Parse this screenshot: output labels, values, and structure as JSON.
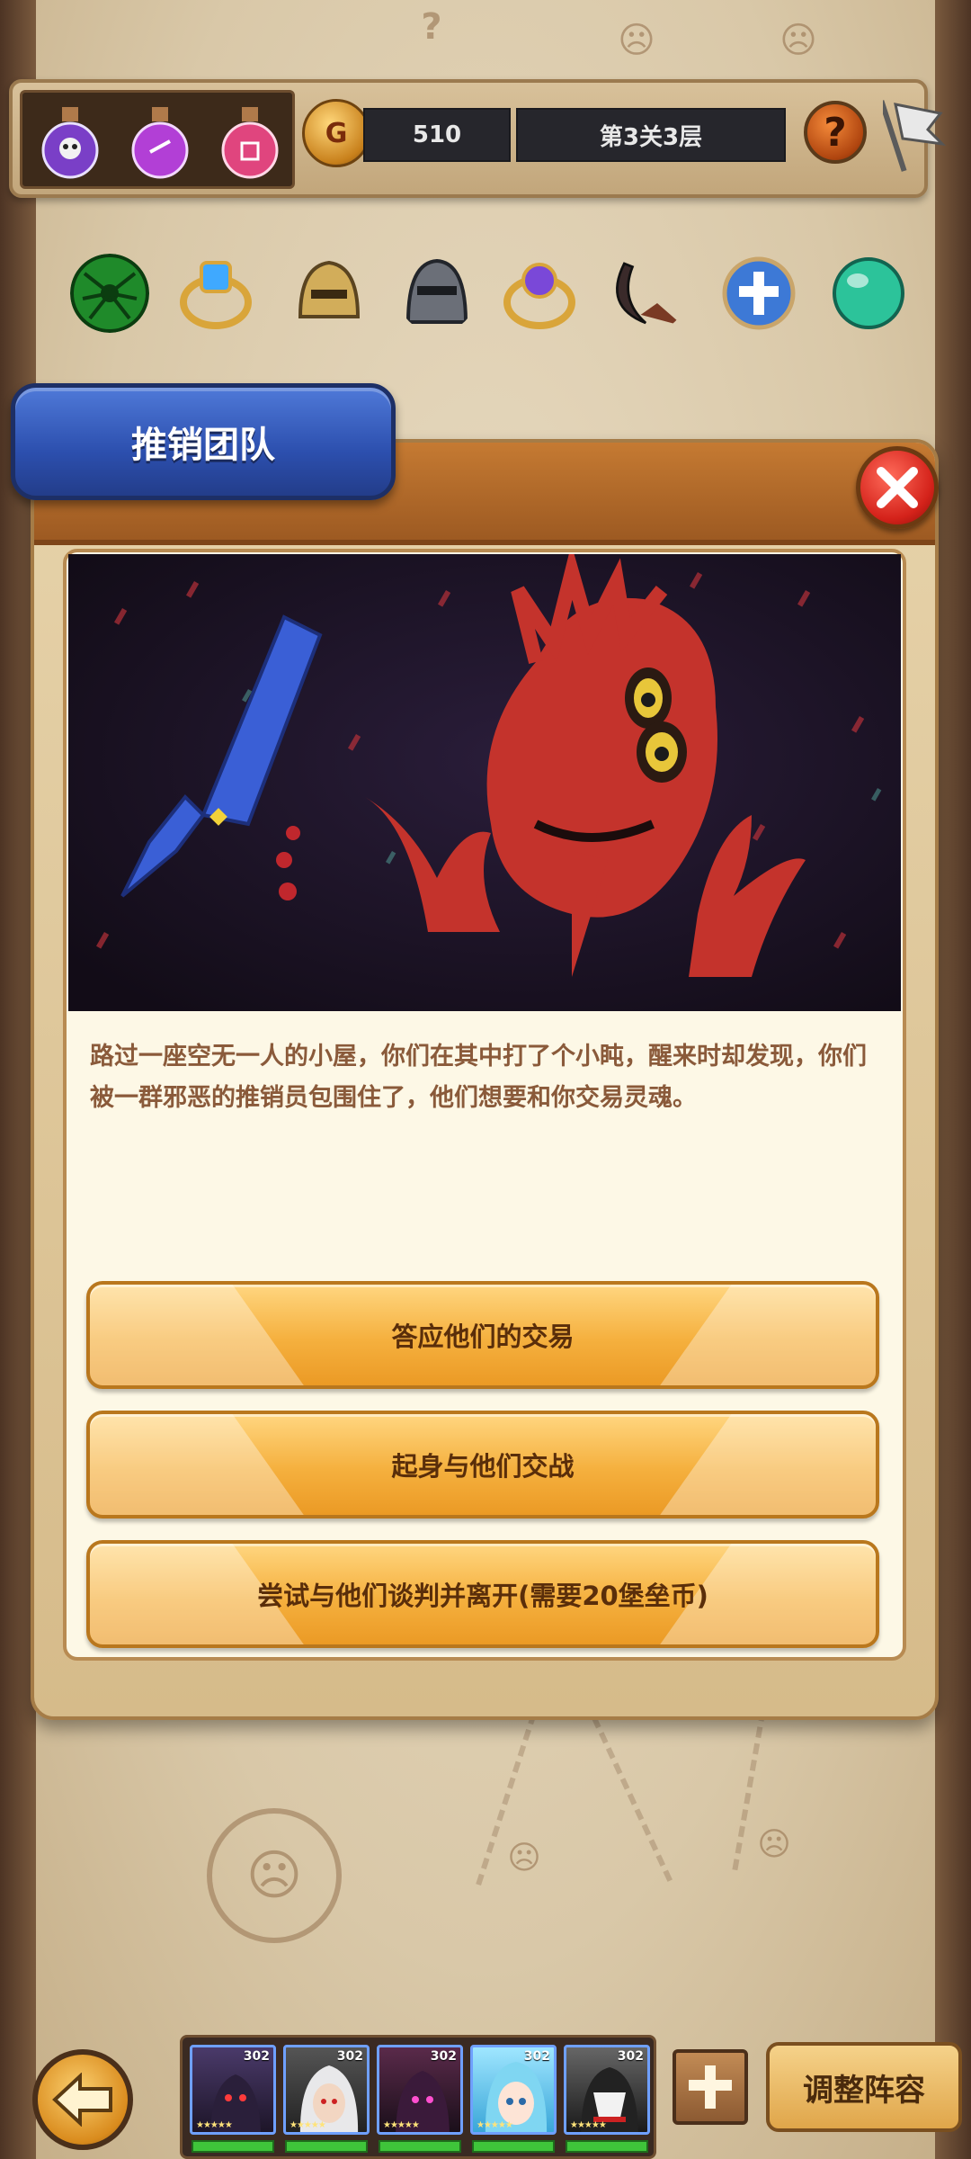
{
  "header": {
    "gold": "510",
    "gold_icon_letter": "G",
    "level": "第3关3层",
    "help": "?",
    "potions": [
      "skull-potion-icon",
      "purple-potion-icon",
      "pink-potion-icon"
    ]
  },
  "relics": [
    "spider-emblem-icon",
    "blue-gem-ring-icon",
    "gold-helmet-icon",
    "steel-helmet-icon",
    "purple-ring-icon",
    "scythe-icon",
    "holy-shield-icon",
    "green-orb-icon"
  ],
  "event": {
    "title": "推销团队",
    "description": "路过一座空无一人的小屋，你们在其中打了个小盹，醒来时却发现，你们被一群邪恶的推销员包围住了，他们想要和你交易灵魂。",
    "choices": [
      {
        "label": "答应他们的交易"
      },
      {
        "label": "起身与他们交战"
      },
      {
        "label": "尝试与他们谈判并离开(需要20堡垒币)"
      }
    ]
  },
  "team": {
    "heroes": [
      {
        "level": "302",
        "portrait": "dark-knight-portrait"
      },
      {
        "level": "302",
        "portrait": "white-hair-warrior-portrait"
      },
      {
        "level": "302",
        "portrait": "shadow-mage-portrait"
      },
      {
        "level": "302",
        "portrait": "blue-hair-girl-portrait"
      },
      {
        "level": "302",
        "portrait": "masked-assassin-portrait"
      }
    ],
    "formation_label": "调整阵容"
  },
  "colors": {
    "modal_tab": "#2c4fae",
    "close_button": "#d4221a",
    "choice_button": "#f5b03e",
    "event_text": "#8a5a3a"
  }
}
